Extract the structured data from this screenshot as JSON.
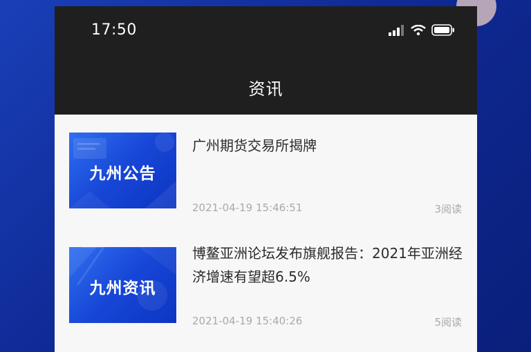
{
  "status_bar": {
    "time": "17:50",
    "icons": [
      "signal-icon",
      "wifi-icon",
      "battery-icon"
    ]
  },
  "header": {
    "title": "资讯"
  },
  "news": [
    {
      "thumb_label": "九州公告",
      "title": "广州期货交易所揭牌",
      "time": "2021-04-19 15:46:51",
      "reads": "3阅读"
    },
    {
      "thumb_label": "九州资讯",
      "title": "博鳌亚洲论坛发布旗舰报告：2021年亚洲经济增速有望超6.5%",
      "time": "2021-04-19 15:40:26",
      "reads": "5阅读"
    }
  ],
  "colors": {
    "background_blue": "#0f2a95",
    "header_bg": "#1f1f1f",
    "thumb_blue": "#1746d6",
    "muted_text": "#a9a9a9"
  }
}
